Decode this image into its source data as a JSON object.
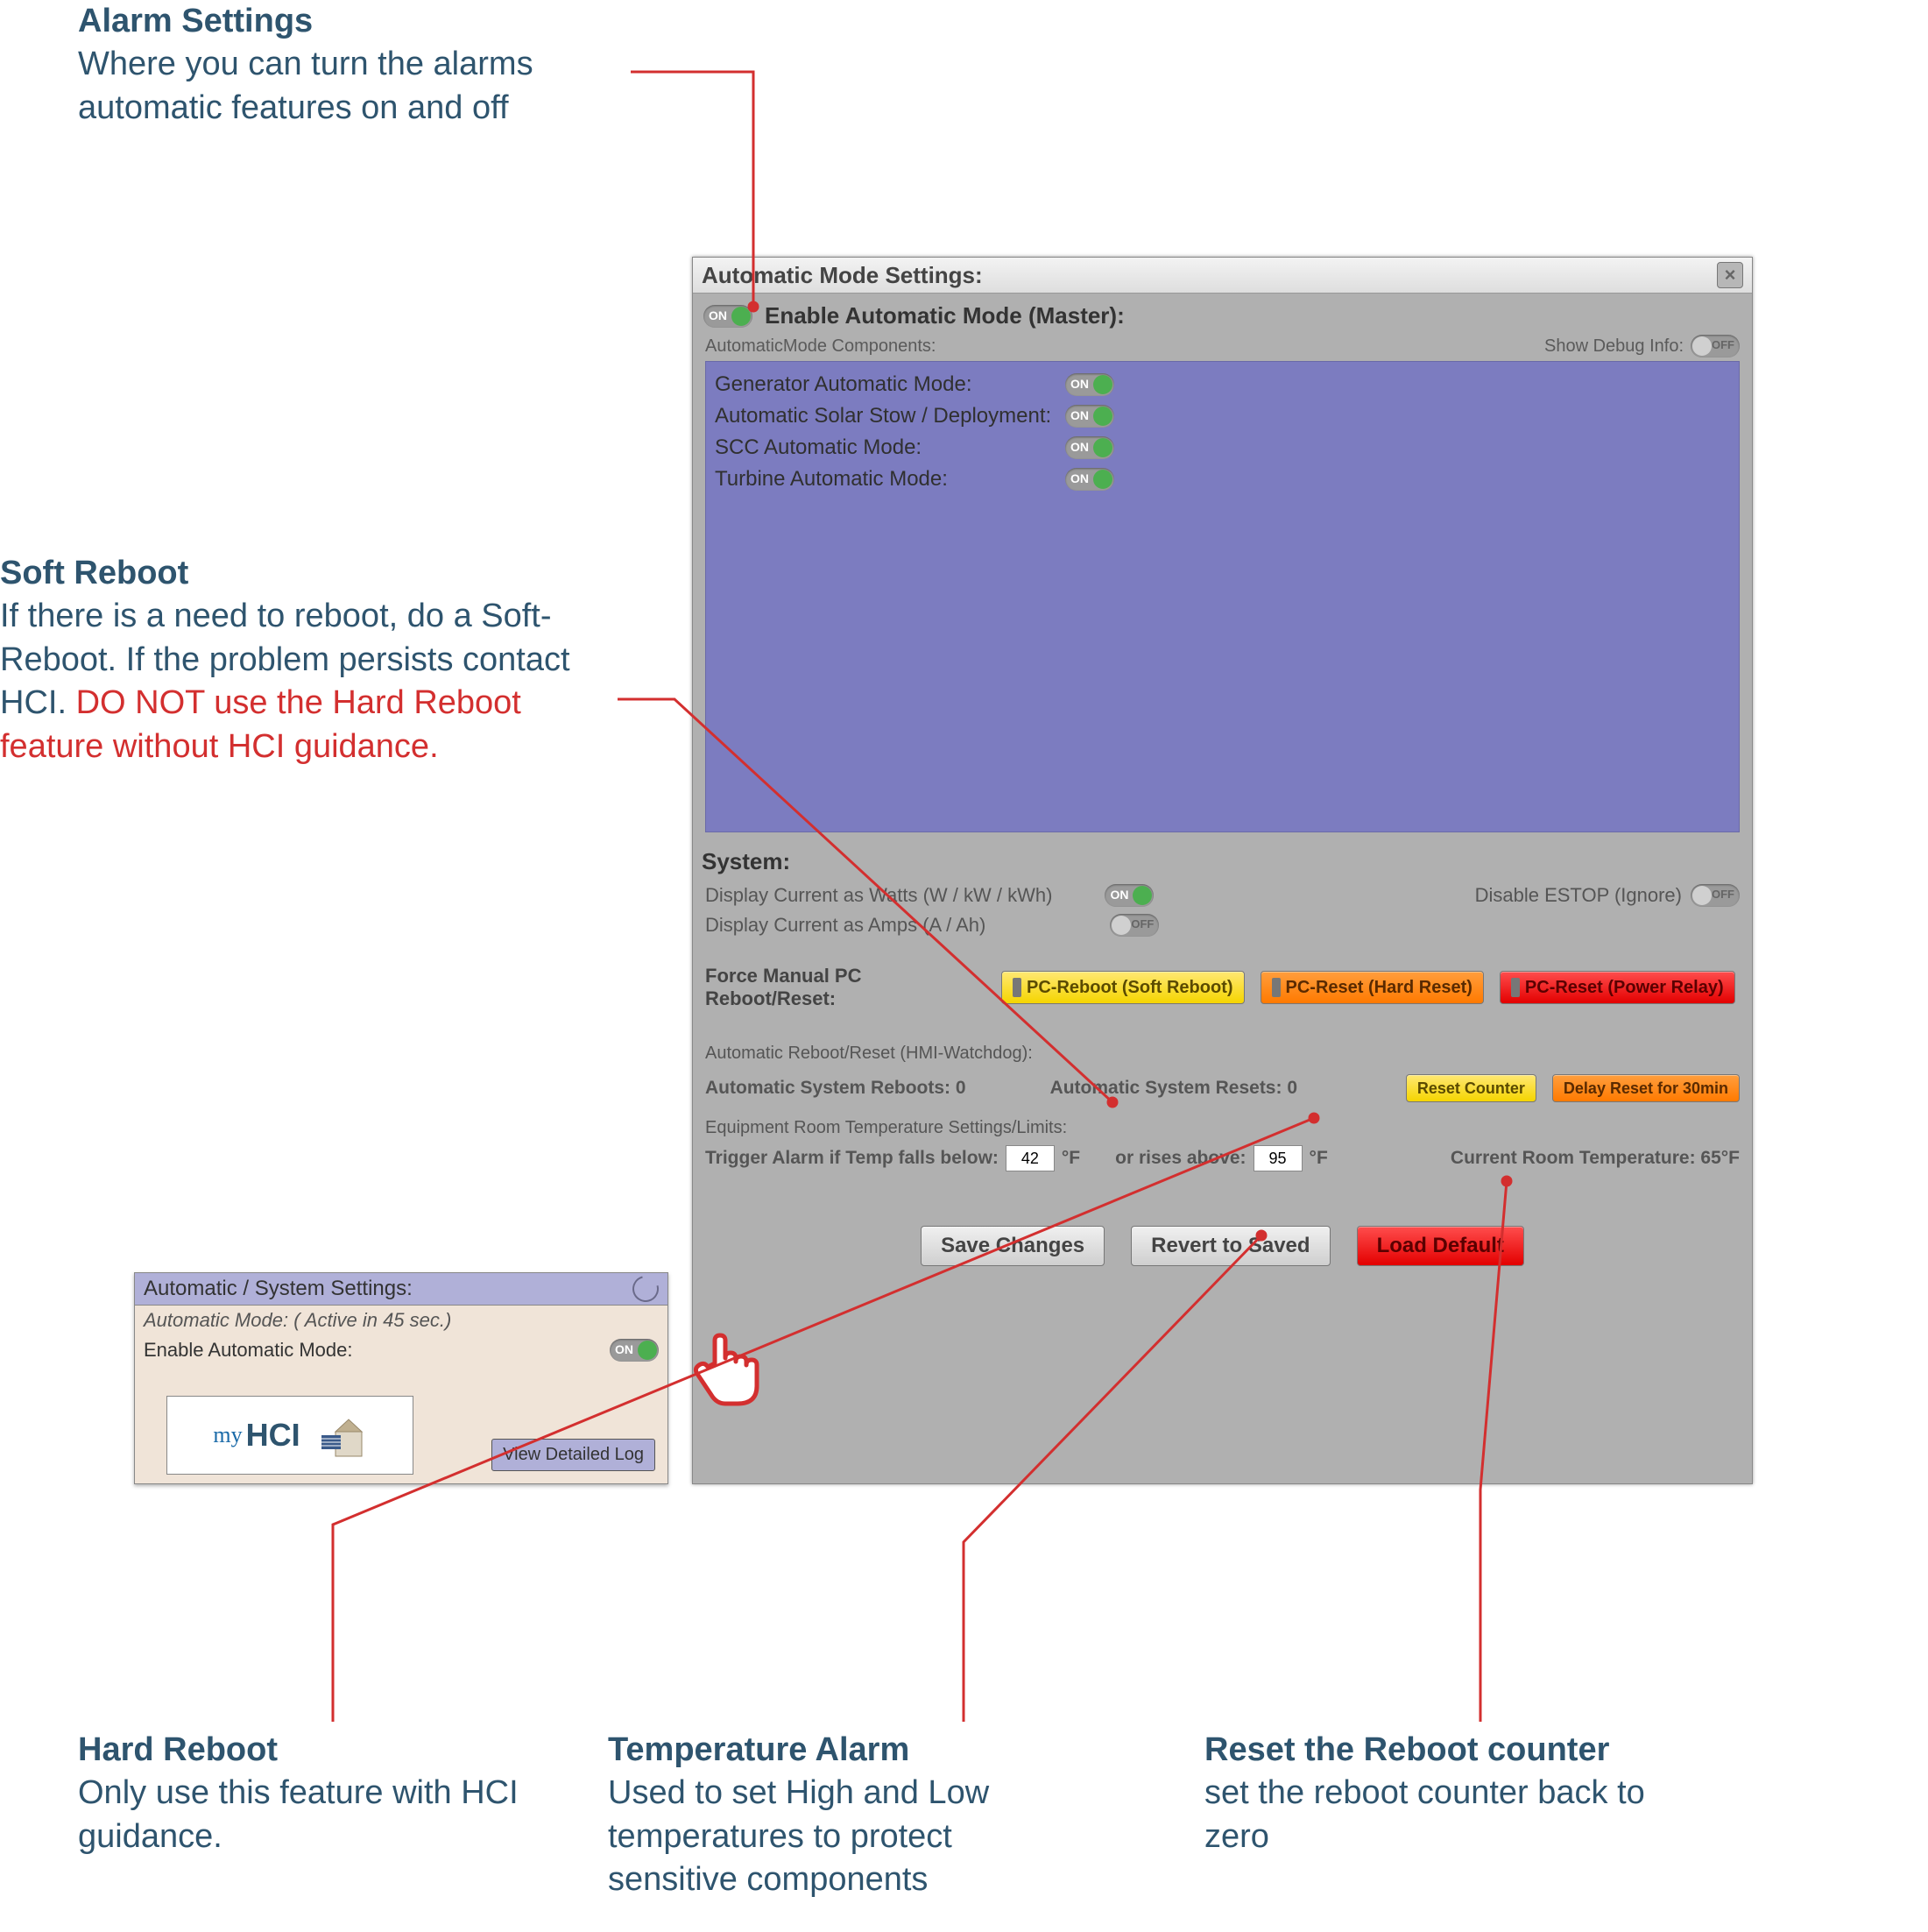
{
  "callouts": {
    "alarm": {
      "title": "Alarm Settings",
      "body": "Where you can turn the alarms automatic features on and off"
    },
    "soft": {
      "title": "Soft Reboot",
      "body": "If there is a need to reboot, do a Soft-Reboot. If the problem persists contact HCI. ",
      "warn": "DO NOT use the Hard Reboot feature without HCI guidance."
    },
    "hard": {
      "title": "Hard Reboot",
      "body": "Only use this feature with HCI guidance."
    },
    "temp": {
      "title": "Temperature Alarm",
      "body": "Used to set High and Low temperatures to protect sensitive components"
    },
    "reset": {
      "title": "Reset the Reboot counter",
      "body": "set the reboot counter back to zero"
    }
  },
  "dialog": {
    "title": "Automatic Mode Settings:",
    "masterLabel": "Enable Automatic Mode (Master):",
    "componentsHeader": "AutomaticMode Components:",
    "debugLabel": "Show Debug Info:",
    "components": [
      {
        "label": "Generator Automatic Mode:"
      },
      {
        "label": "Automatic Solar Stow / Deployment:"
      },
      {
        "label": "SCC Automatic Mode:"
      },
      {
        "label": "Turbine Automatic Mode:"
      }
    ],
    "systemHeader": "System:",
    "displayWatts": "Display Current as Watts (W / kW / kWh)",
    "displayAmps": "Display Current as Amps (A / Ah)",
    "disableEstop": "Disable ESTOP (Ignore)",
    "forceLabel": "Force Manual PC Reboot/Reset:",
    "btnSoft": "PC-Reboot (Soft Reboot)",
    "btnHard": "PC-Reset (Hard Reset)",
    "btnRelay": "PC-Reset (Power Relay)",
    "watchdogHeader": "Automatic Reboot/Reset (HMI-Watchdog):",
    "autoReboots": "Automatic System Reboots: 0",
    "autoResets": "Automatic System Resets: 0",
    "btnResetCounter": "Reset Counter",
    "btnDelay": "Delay Reset for 30min",
    "tempHeader": "Equipment Room Temperature Settings/Limits:",
    "tempFalls": "Trigger Alarm if Temp falls below:",
    "tempLow": "42",
    "degF1": "°F",
    "tempRises": "or rises above:",
    "tempHigh": "95",
    "degF2": "°F",
    "currentTemp": "Current Room Temperature: 65°F",
    "btnSave": "Save Changes",
    "btnRevert": "Revert to Saved",
    "btnLoad": "Load Default"
  },
  "smallPanel": {
    "header": "Automatic / System Settings:",
    "activeLine": "Automatic Mode: ( Active in 45 sec.)",
    "enableLabel": "Enable Automatic Mode:",
    "logoMy": "my",
    "logoHCI": "HCI",
    "viewBtn": "View Detailed Log"
  }
}
